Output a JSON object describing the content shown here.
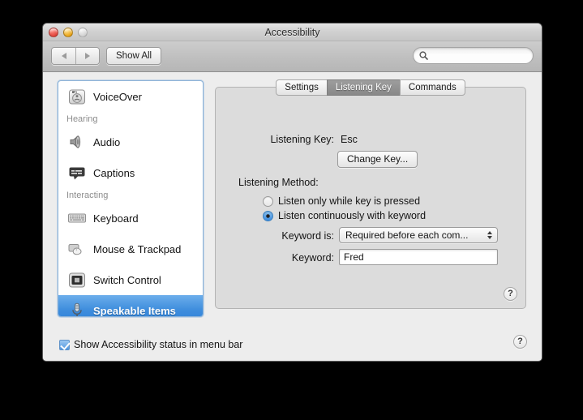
{
  "window": {
    "title": "Accessibility",
    "traffic_lights": [
      {
        "name": "close-button",
        "color": "#e0453c",
        "enabled": true
      },
      {
        "name": "minimize-button",
        "color": "#e8a317",
        "enabled": true
      },
      {
        "name": "zoom-button",
        "color": "#cfcfcf",
        "enabled": false
      }
    ]
  },
  "toolbar": {
    "back_label": "Back",
    "forward_label": "Forward",
    "show_all_label": "Show All",
    "search": {
      "value": "",
      "placeholder": "",
      "icon": "search-icon"
    }
  },
  "sidebar": {
    "items": [
      {
        "type": "item",
        "label": "VoiceOver",
        "icon": "voiceover-icon",
        "selected": false
      },
      {
        "type": "header",
        "label": "Hearing"
      },
      {
        "type": "item",
        "label": "Audio",
        "icon": "speaker-icon",
        "selected": false
      },
      {
        "type": "item",
        "label": "Captions",
        "icon": "captions-icon",
        "selected": false
      },
      {
        "type": "header",
        "label": "Interacting"
      },
      {
        "type": "item",
        "label": "Keyboard",
        "icon": "keyboard-icon",
        "selected": false
      },
      {
        "type": "item",
        "label": "Mouse & Trackpad",
        "icon": "mouse-trackpad-icon",
        "selected": false
      },
      {
        "type": "item",
        "label": "Switch Control",
        "icon": "switch-control-icon",
        "selected": false
      },
      {
        "type": "item",
        "label": "Speakable Items",
        "icon": "microphone-icon",
        "selected": true
      }
    ]
  },
  "panel": {
    "tabs": [
      {
        "label": "Settings",
        "active": false
      },
      {
        "label": "Listening Key",
        "active": true
      },
      {
        "label": "Commands",
        "active": false
      }
    ],
    "listening_key_label": "Listening Key:",
    "listening_key_value": "Esc",
    "change_key_label": "Change Key...",
    "listening_method_label": "Listening Method:",
    "radios": [
      {
        "label": "Listen only while key is pressed",
        "selected": false
      },
      {
        "label": "Listen continuously with keyword",
        "selected": true
      }
    ],
    "keyword_is_label": "Keyword is:",
    "keyword_is_value": "Required before each com...",
    "keyword_label": "Keyword:",
    "keyword_value": "Fred",
    "help_label": "?"
  },
  "footer": {
    "checkbox_label": "Show Accessibility status in menu bar",
    "checkbox_checked": true,
    "help_label": "?"
  },
  "colors": {
    "selection_blue": "#3e8ddd",
    "window_bg": "#ededed",
    "panel_bg": "#dcdcdc",
    "active_tab": "#8d8d8d"
  }
}
